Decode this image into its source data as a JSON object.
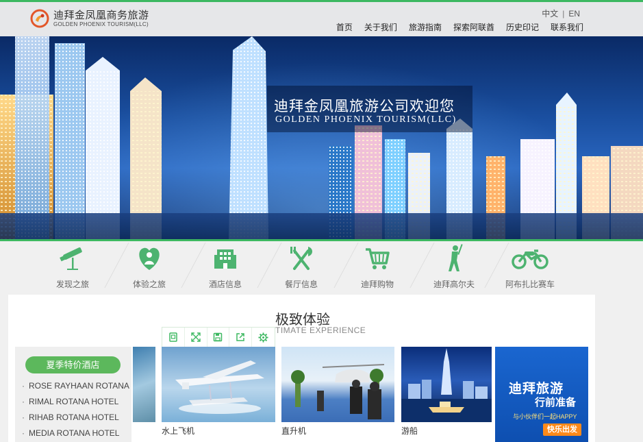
{
  "logo": {
    "name_cn": "迪拜金凤凰商务旅游",
    "name_en": "GOLDEN PHOENIX TOURISM(LLC)"
  },
  "lang": {
    "zh": "中文",
    "sep": "|",
    "en": "EN"
  },
  "nav": [
    {
      "label": "首页"
    },
    {
      "label": "关于我们"
    },
    {
      "label": "旅游指南"
    },
    {
      "label": "探索阿联酋"
    },
    {
      "label": "历史印记"
    },
    {
      "label": "联系我们"
    }
  ],
  "banner": {
    "title_cn": "迪拜金凤凰旅游公司欢迎您",
    "title_en": "GOLDEN PHOENIX TOURISM(LLC)",
    "slide_count": 5,
    "active_slide": 2
  },
  "iconbar": [
    {
      "label": "发现之旅",
      "icon": "telescope-icon"
    },
    {
      "label": "体验之旅",
      "icon": "heart-person-icon"
    },
    {
      "label": "酒店信息",
      "icon": "hotel-icon"
    },
    {
      "label": "餐厅信息",
      "icon": "fork-knife-icon"
    },
    {
      "label": "迪拜购物",
      "icon": "cart-icon"
    },
    {
      "label": "迪拜高尔夫",
      "icon": "golf-icon"
    },
    {
      "label": "阿布扎比赛车",
      "icon": "motorcycle-icon"
    }
  ],
  "section": {
    "title": "极致体验",
    "subtitle": "TIMATE EXPERIENCE"
  },
  "toolbar": [
    "copy-icon",
    "expand-icon",
    "save-icon",
    "share-icon",
    "settings-icon"
  ],
  "hotels": {
    "button": "夏季特价酒店",
    "items": [
      "ROSE RAYHAAN ROTANA",
      "RIMAL ROTANA HOTEL",
      "RIHAB ROTANA HOTEL",
      "MEDIA ROTANA HOTEL"
    ]
  },
  "cards": [
    {
      "caption": "水上飞机"
    },
    {
      "caption": "直升机"
    },
    {
      "caption": "游船"
    }
  ],
  "ad": {
    "line1": "迪拜旅游",
    "line2": "行前准备",
    "line3": "与小伙伴们一起HAPPY",
    "button": "快乐出发"
  },
  "colors": {
    "accent": "#3db861",
    "button": "#5cb85c",
    "icon": "#4db370"
  }
}
